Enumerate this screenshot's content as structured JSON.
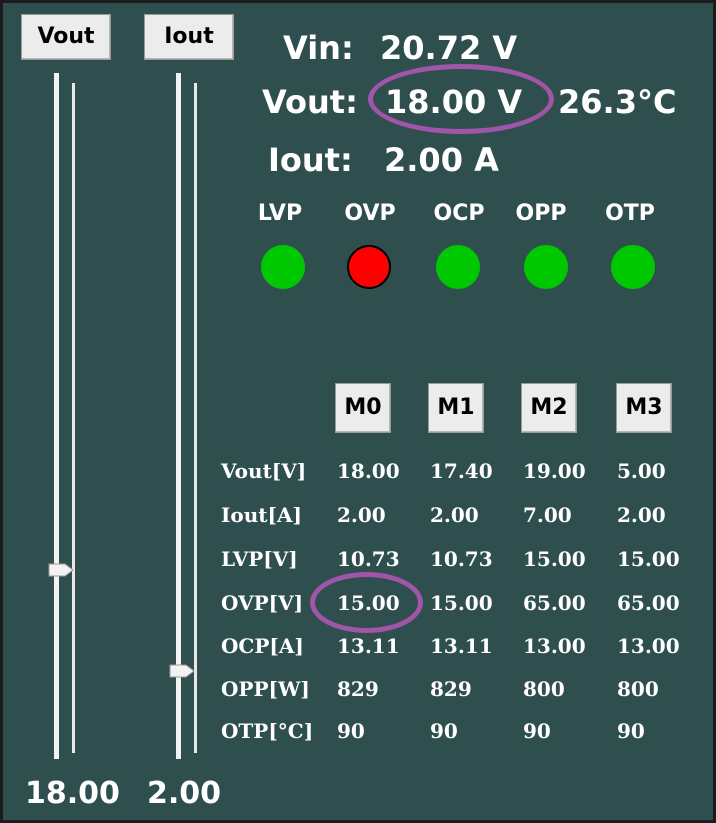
{
  "sliders": {
    "vout": {
      "label": "Vout",
      "value": "18.00",
      "level": 0.26
    },
    "iout": {
      "label": "Iout",
      "value": "2.00",
      "level": 0.11
    }
  },
  "readouts": {
    "vin": {
      "label": "Vin:",
      "value": "20.72 V"
    },
    "vout": {
      "label": "Vout:",
      "value": "18.00 V"
    },
    "temperature": "26.3°C",
    "iout": {
      "label": "Iout:",
      "value": "2.00 A"
    }
  },
  "indicators": [
    {
      "label": "LVP",
      "state": "ok"
    },
    {
      "label": "OVP",
      "state": "trip"
    },
    {
      "label": "OCP",
      "state": "ok"
    },
    {
      "label": "OPP",
      "state": "ok"
    },
    {
      "label": "OTP",
      "state": "ok"
    }
  ],
  "colors": {
    "background": "#2f4f4f",
    "ok": "#00c800",
    "trip": "#ff0000",
    "highlight": "#a055a8"
  },
  "memory": {
    "buttons": [
      "M0",
      "M1",
      "M2",
      "M3"
    ],
    "rows": [
      {
        "label": "Vout[V]",
        "values": [
          "18.00",
          "17.40",
          "19.00",
          "5.00"
        ]
      },
      {
        "label": "Iout[A]",
        "values": [
          "2.00",
          "2.00",
          "7.00",
          "2.00"
        ]
      },
      {
        "label": "LVP[V]",
        "values": [
          "10.73",
          "10.73",
          "15.00",
          "15.00"
        ]
      },
      {
        "label": "OVP[V]",
        "values": [
          "15.00",
          "15.00",
          "65.00",
          "65.00"
        ]
      },
      {
        "label": "OCP[A]",
        "values": [
          "13.11",
          "13.11",
          "13.00",
          "13.00"
        ]
      },
      {
        "label": "OPP[W]",
        "values": [
          "829",
          "829",
          "800",
          "800"
        ]
      },
      {
        "label": "OTP[°C]",
        "values": [
          "90",
          "90",
          "90",
          "90"
        ]
      }
    ]
  }
}
